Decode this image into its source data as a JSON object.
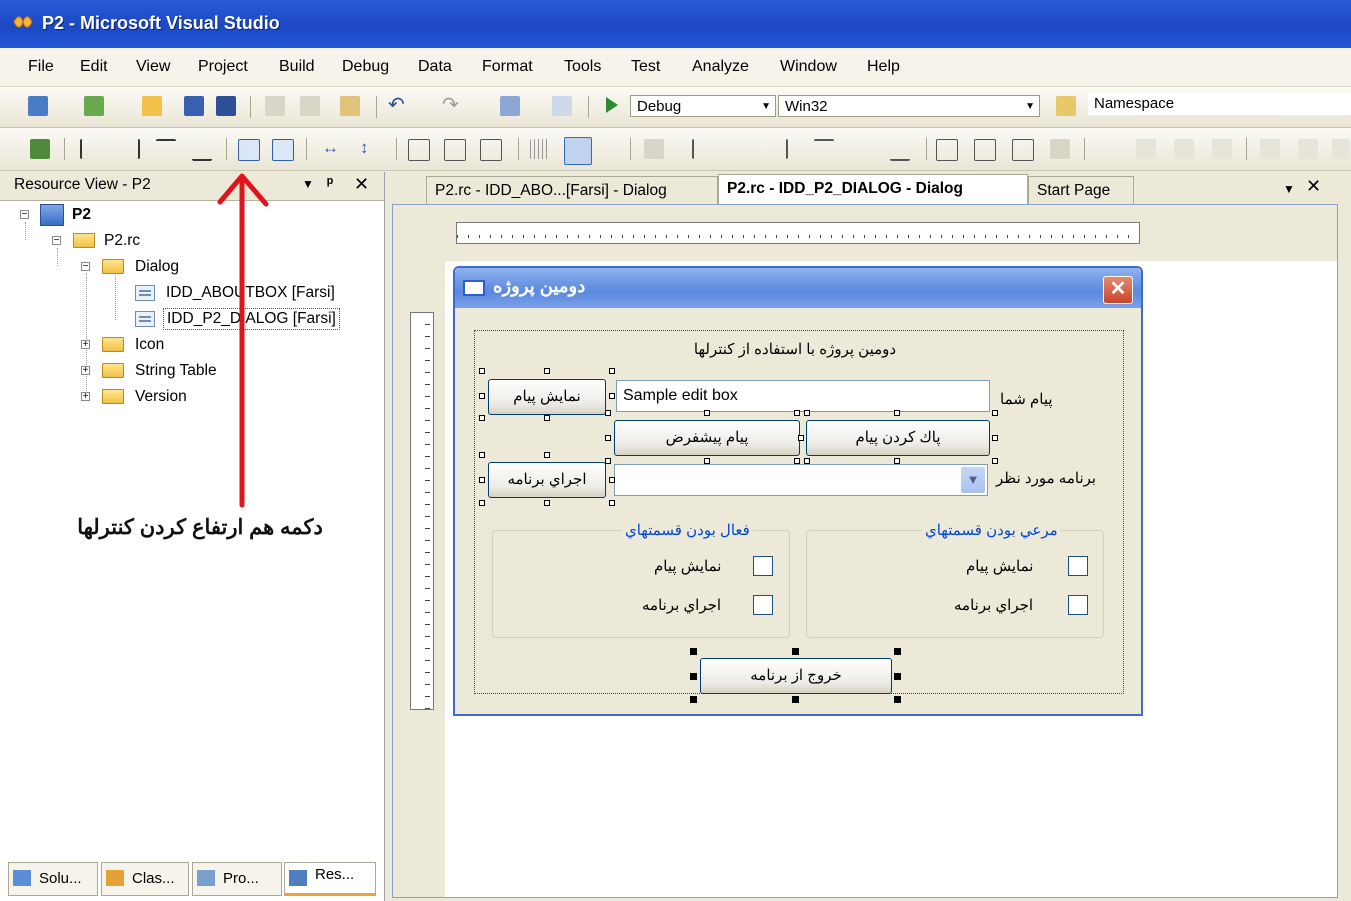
{
  "window": {
    "title": "P2 - Microsoft Visual Studio"
  },
  "menu": [
    "File",
    "Edit",
    "View",
    "Project",
    "Build",
    "Debug",
    "Data",
    "Format",
    "Tools",
    "Test",
    "Analyze",
    "Window",
    "Help"
  ],
  "toolbar": {
    "config": "Debug",
    "platform": "Win32",
    "namespace_label": "Namespace"
  },
  "resource_view": {
    "title": "Resource View - P2",
    "pin": "ᵖ",
    "close": "✕",
    "tree": {
      "root": "P2",
      "rc": "P2.rc",
      "dialog": "Dialog",
      "aboutbox": "IDD_ABOUTBOX [Farsi]",
      "p2dialog": "IDD_P2_DIALOG [Farsi]",
      "icon": "Icon",
      "string_table": "String Table",
      "version": "Version"
    }
  },
  "annotation": {
    "text": "دکمه هم ارتفاع کردن کنترلها"
  },
  "bottom_tabs": [
    "Solu...",
    "Clas...",
    "Pro...",
    "Res..."
  ],
  "editor_tabs": [
    "P2.rc - IDD_ABO...[Farsi] - Dialog",
    "P2.rc - IDD_P2_DIALOG - Dialog",
    "Start Page"
  ],
  "dialog": {
    "title": "دومین پروژه",
    "caption": "دومین پروژه با استفاده از کنترلها",
    "edit_value": "Sample edit box",
    "label_message": "پیام شما",
    "label_program": "برنامه مورد نظر",
    "btn_show": "نمايش پيام",
    "btn_clear": "پاك كردن پيام",
    "btn_default": "پيام پيشفرض",
    "btn_run": "اجراي برنامه",
    "group_visible": "مرعي بودن قسمتهاي",
    "group_active": "فعال بودن قسمتهاي",
    "chk_show": "نمايش پيام",
    "chk_run": "اجراي برنامه",
    "btn_exit": "خروج از برنامه"
  },
  "colors": {
    "title_blue": "#1c48c4",
    "annotation_red": "#e0141c",
    "group_label": "#0046d5"
  }
}
